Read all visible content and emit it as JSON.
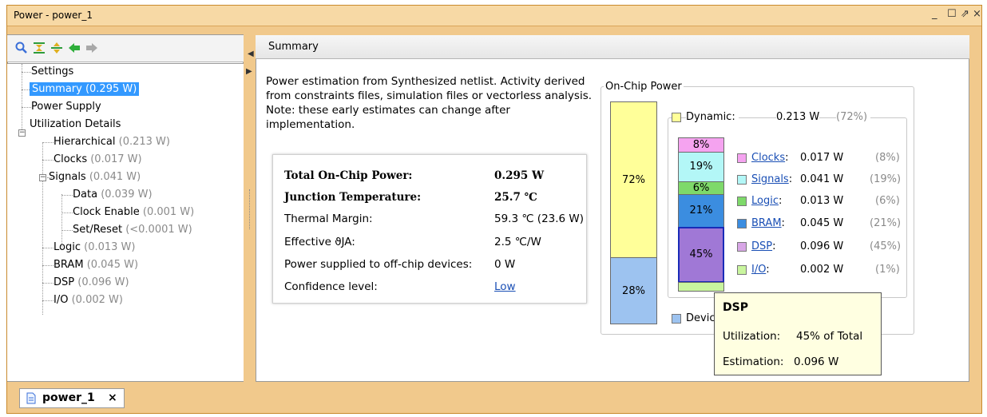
{
  "window": {
    "title": "Power - power_1",
    "controls": [
      "_",
      "☐",
      "⇗",
      "×"
    ]
  },
  "toolbar": {
    "icons": [
      "search-icon",
      "collapse-all-icon",
      "expand-all-icon",
      "back-arrow-icon",
      "forward-arrow-icon"
    ]
  },
  "tree": {
    "items": [
      {
        "label": "Settings",
        "value": ""
      },
      {
        "label": "Summary (0.295 W)",
        "value": ""
      },
      {
        "label": "Power Supply",
        "value": ""
      },
      {
        "label": "Utilization Details",
        "value": ""
      },
      {
        "label": "Hierarchical",
        "value": "(0.213 W)"
      },
      {
        "label": "Clocks",
        "value": "(0.017 W)"
      },
      {
        "label": "Signals",
        "value": "(0.041 W)"
      },
      {
        "label": "Data",
        "value": "(0.039 W)"
      },
      {
        "label": "Clock Enable",
        "value": "(0.001 W)"
      },
      {
        "label": "Set/Reset",
        "value": "(<0.0001 W)"
      },
      {
        "label": "Logic",
        "value": "(0.013 W)"
      },
      {
        "label": "BRAM",
        "value": "(0.045 W)"
      },
      {
        "label": "DSP",
        "value": "(0.096 W)"
      },
      {
        "label": "I/O",
        "value": "(0.002 W)"
      }
    ]
  },
  "summary": {
    "header": "Summary",
    "description": "Power estimation from Synthesized netlist. Activity derived from constraints files, simulation files or vectorless analysis. Note: these early estimates can change after implementation.",
    "stats": [
      {
        "label": "Total On-Chip Power:",
        "value": "0.295 W"
      },
      {
        "label": "Junction Temperature:",
        "value": "25.7 ℃"
      },
      {
        "label": "Thermal Margin:",
        "value": "59.3 ℃ (23.6 W)"
      },
      {
        "label": "Effective ϑJA:",
        "value": "2.5 ℃/W"
      },
      {
        "label": "Power supplied to off-chip devices:",
        "value": "0 W"
      },
      {
        "label": "Confidence level:",
        "value": "Low"
      }
    ]
  },
  "chip_power": {
    "legend": "On-Chip Power",
    "main_bar": [
      {
        "label": "72%",
        "color": "#ffff99"
      },
      {
        "label": "28%",
        "color": "#9dc3f0"
      }
    ],
    "dynamic": {
      "label": "Dynamic:",
      "value": "0.213 W",
      "pct": "(72%)",
      "color": "#ffff99"
    },
    "device_static_label": "Devic",
    "dynamic_bar": [
      {
        "label": "8%",
        "color": "#f5a3f0"
      },
      {
        "label": "19%",
        "color": "#b3f7f7"
      },
      {
        "label": "6%",
        "color": "#7ed96a"
      },
      {
        "label": "21%",
        "color": "#3b8de0"
      },
      {
        "label": "45%",
        "color": "#a078d6"
      },
      {
        "label": "",
        "color": "#c9f59e"
      }
    ],
    "breakdown": [
      {
        "name": "Clocks",
        "value": "0.017 W",
        "pct": "(8%)",
        "color": "#f5a3f0"
      },
      {
        "name": "Signals",
        "value": "0.041 W",
        "pct": "(19%)",
        "color": "#b3f7f7"
      },
      {
        "name": "Logic",
        "value": "0.013 W",
        "pct": "(6%)",
        "color": "#7ed96a"
      },
      {
        "name": "BRAM",
        "value": "0.045 W",
        "pct": "(21%)",
        "color": "#3b8de0"
      },
      {
        "name": "DSP",
        "value": "0.096 W",
        "pct": "(45%)",
        "color": "#d8a6e6"
      },
      {
        "name": "I/O",
        "value": "0.002 W",
        "pct": "(1%)",
        "color": "#c9f59e"
      }
    ]
  },
  "tooltip": {
    "title": "DSP",
    "utilization_label": "Utilization:",
    "utilization_value": "45% of Total",
    "estimation_label": "Estimation:",
    "estimation_value": "0.096 W"
  },
  "bottom_tab": {
    "label": "power_1",
    "close": "×"
  }
}
